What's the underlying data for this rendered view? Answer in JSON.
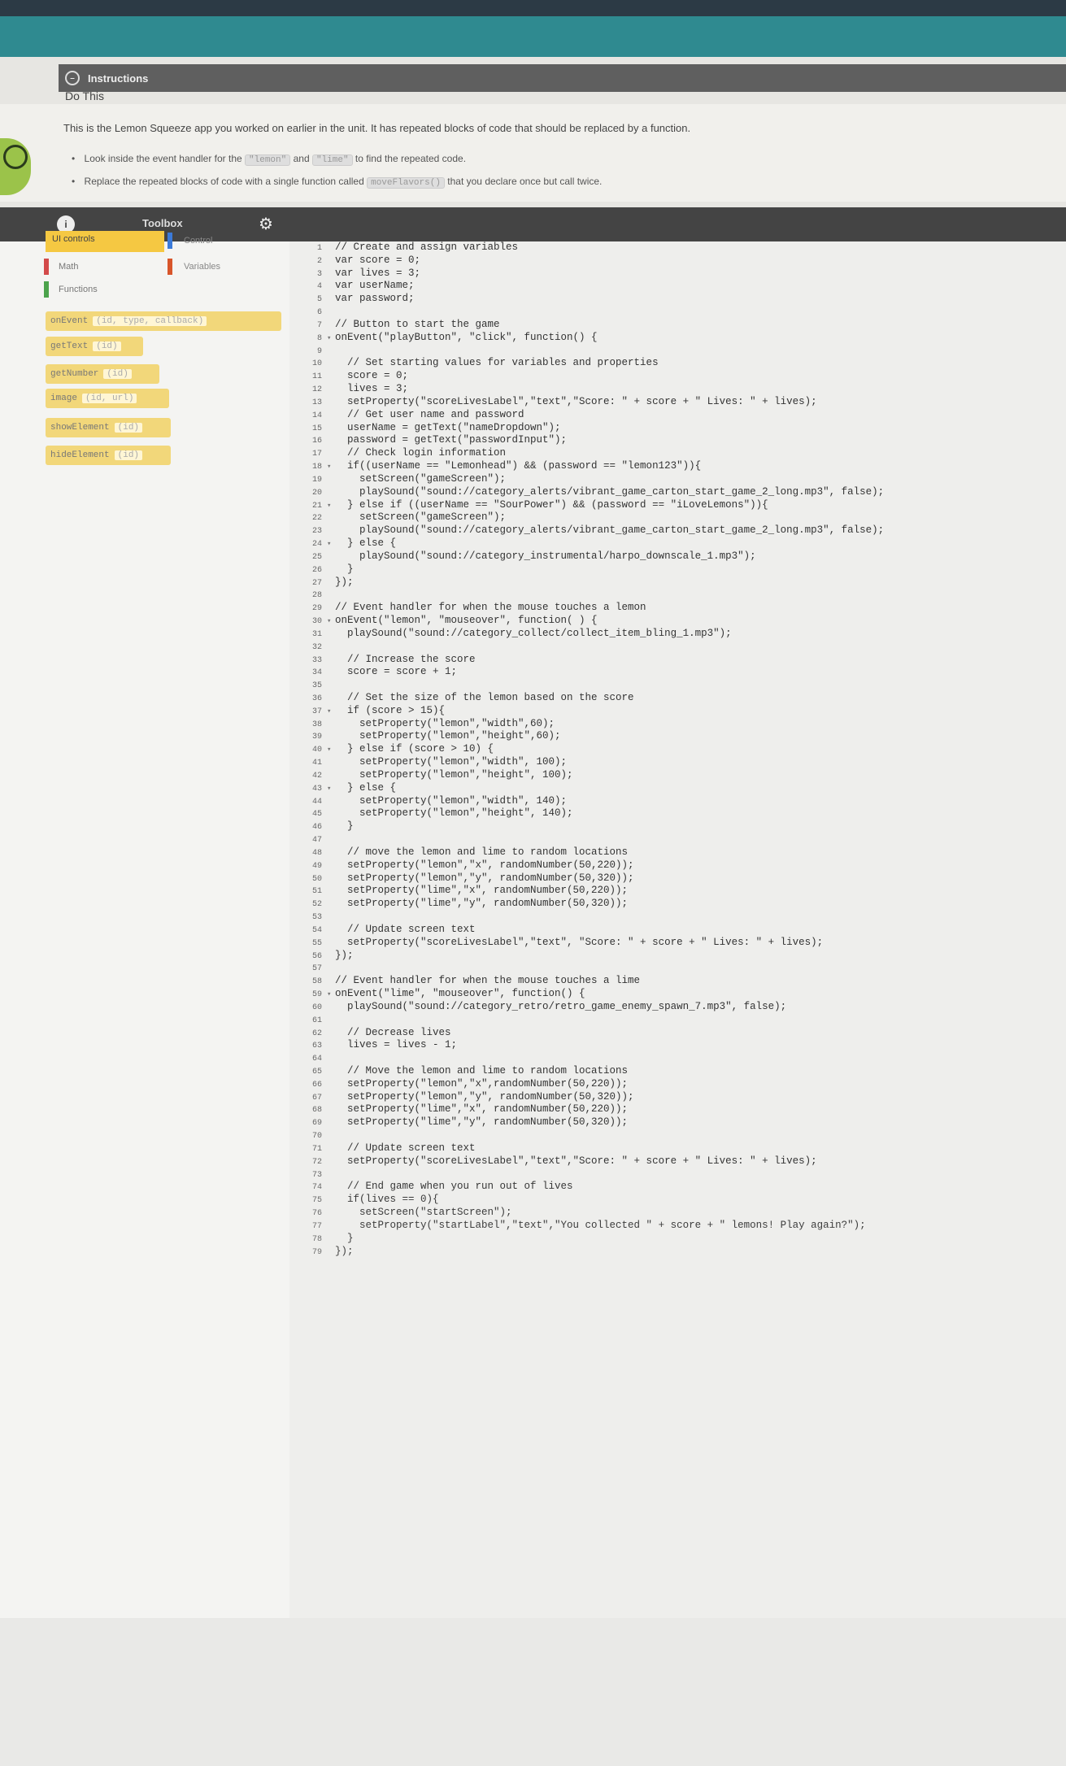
{
  "instructions": {
    "header": "Instructions",
    "do_this": "Do This",
    "intro": "This is the Lemon Squeeze app you worked on earlier in the unit. It has repeated blocks of code that should be replaced by a function.",
    "bullet1_pre": "Look inside the event handler for the",
    "bullet1_chip1": "\"lemon\"",
    "bullet1_mid": "and",
    "bullet1_chip2": "\"lime\"",
    "bullet1_post": "to find the repeated code.",
    "bullet2_pre": "Replace the repeated blocks of code with a single function called",
    "bullet2_chip": "moveFlavors()",
    "bullet2_post": "that you declare once but call twice."
  },
  "toolbox": {
    "title": "Toolbox",
    "categories": [
      "UI controls",
      "Control",
      "Math",
      "Variables",
      "Functions"
    ],
    "blocks": [
      {
        "name": "onEvent",
        "args": "(id, type, callback)"
      },
      {
        "name": "getText",
        "args": "(id)"
      },
      {
        "name": "getNumber",
        "args": "(id)"
      },
      {
        "name": "image",
        "args": "(id, url)"
      },
      {
        "name": "showElement",
        "args": "(id)"
      },
      {
        "name": "hideElement",
        "args": "(id)"
      }
    ]
  },
  "code": {
    "lines": [
      "// Create and assign variables",
      "var score = 0;",
      "var lives = 3;",
      "var userName;",
      "var password;",
      "",
      "// Button to start the game",
      "onEvent(\"playButton\", \"click\", function() {",
      "",
      "  // Set starting values for variables and properties",
      "  score = 0;",
      "  lives = 3;",
      "  setProperty(\"scoreLivesLabel\",\"text\",\"Score: \" + score + \" Lives: \" + lives);",
      "  // Get user name and password",
      "  userName = getText(\"nameDropdown\");",
      "  password = getText(\"passwordInput\");",
      "  // Check login information",
      "  if((userName == \"Lemonhead\") && (password == \"lemon123\")){",
      "    setScreen(\"gameScreen\");",
      "    playSound(\"sound://category_alerts/vibrant_game_carton_start_game_2_long.mp3\", false);",
      "  } else if ((userName == \"SourPower\") && (password == \"iLoveLemons\")){",
      "    setScreen(\"gameScreen\");",
      "    playSound(\"sound://category_alerts/vibrant_game_carton_start_game_2_long.mp3\", false);",
      "  } else {",
      "    playSound(\"sound://category_instrumental/harpo_downscale_1.mp3\");",
      "  }",
      "});",
      "",
      "// Event handler for when the mouse touches a lemon",
      "onEvent(\"lemon\", \"mouseover\", function( ) {",
      "  playSound(\"sound://category_collect/collect_item_bling_1.mp3\");",
      "",
      "  // Increase the score",
      "  score = score + 1;",
      "",
      "  // Set the size of the lemon based on the score",
      "  if (score > 15){",
      "    setProperty(\"lemon\",\"width\",60);",
      "    setProperty(\"lemon\",\"height\",60);",
      "  } else if (score > 10) {",
      "    setProperty(\"lemon\",\"width\", 100);",
      "    setProperty(\"lemon\",\"height\", 100);",
      "  } else {",
      "    setProperty(\"lemon\",\"width\", 140);",
      "    setProperty(\"lemon\",\"height\", 140);",
      "  }",
      "",
      "  // move the lemon and lime to random locations",
      "  setProperty(\"lemon\",\"x\", randomNumber(50,220));",
      "  setProperty(\"lemon\",\"y\", randomNumber(50,320));",
      "  setProperty(\"lime\",\"x\", randomNumber(50,220));",
      "  setProperty(\"lime\",\"y\", randomNumber(50,320));",
      "",
      "  // Update screen text",
      "  setProperty(\"scoreLivesLabel\",\"text\", \"Score: \" + score + \" Lives: \" + lives);",
      "});",
      "",
      "// Event handler for when the mouse touches a lime",
      "onEvent(\"lime\", \"mouseover\", function() {",
      "  playSound(\"sound://category_retro/retro_game_enemy_spawn_7.mp3\", false);",
      "",
      "  // Decrease lives",
      "  lives = lives - 1;",
      "",
      "  // Move the lemon and lime to random locations",
      "  setProperty(\"lemon\",\"x\",randomNumber(50,220));",
      "  setProperty(\"lemon\",\"y\", randomNumber(50,320));",
      "  setProperty(\"lime\",\"x\", randomNumber(50,220));",
      "  setProperty(\"lime\",\"y\", randomNumber(50,320));",
      "",
      "  // Update screen text",
      "  setProperty(\"scoreLivesLabel\",\"text\",\"Score: \" + score + \" Lives: \" + lives);",
      "",
      "  // End game when you run out of lives",
      "  if(lives == 0){",
      "    setScreen(\"startScreen\");",
      "    setProperty(\"startLabel\",\"text\",\"You collected \" + score + \" lemons! Play again?\");",
      "  }",
      "});"
    ],
    "fold_lines": [
      8,
      18,
      21,
      24,
      30,
      37,
      40,
      43,
      59
    ]
  },
  "colors": {
    "teal_bar": "#2f8a90",
    "ui_category": "#f5c842",
    "ui_block": "#f2d77a"
  }
}
